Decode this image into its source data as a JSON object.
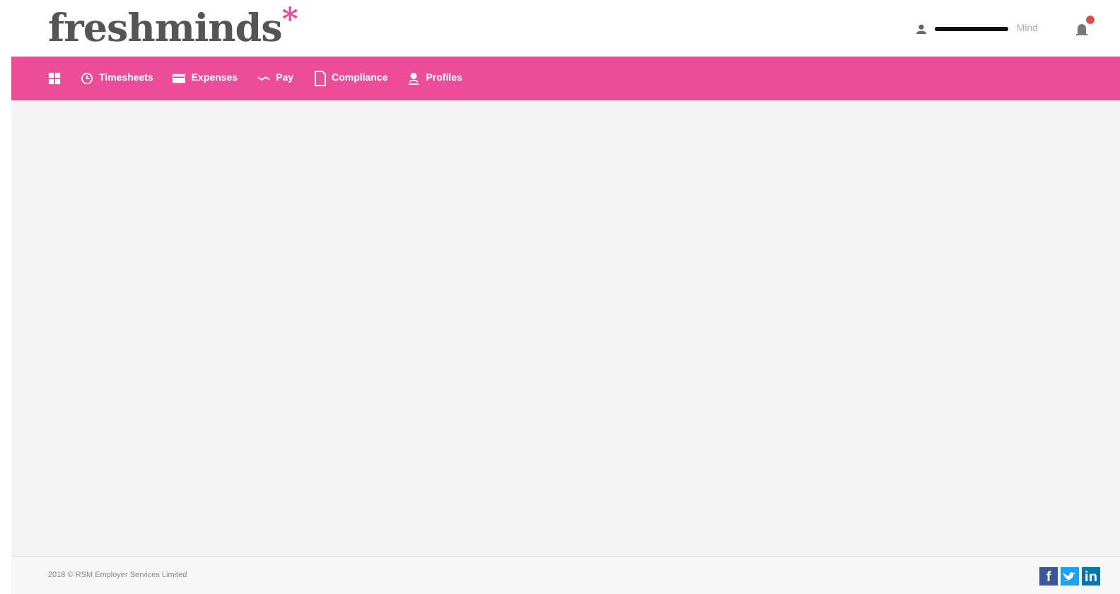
{
  "logo": {
    "text": "freshminds",
    "mark": "*"
  },
  "user": {
    "name": "Mind",
    "redacted": true
  },
  "notifications": {
    "badge": true
  },
  "nav": [
    {
      "kind": "grid"
    },
    {
      "kind": "clock",
      "label": "Timesheets"
    },
    {
      "kind": "card",
      "label": "Expenses"
    },
    {
      "kind": "pay",
      "label": "Pay"
    },
    {
      "kind": "doc",
      "label": "Compliance"
    },
    {
      "kind": "user",
      "label": "Profiles"
    }
  ],
  "footer": {
    "copyright": "2018 © RSM Employer Services Limited",
    "social": [
      {
        "kind": "facebook",
        "label": "f"
      },
      {
        "kind": "twitter"
      },
      {
        "kind": "linkedin",
        "label": "in"
      }
    ]
  }
}
